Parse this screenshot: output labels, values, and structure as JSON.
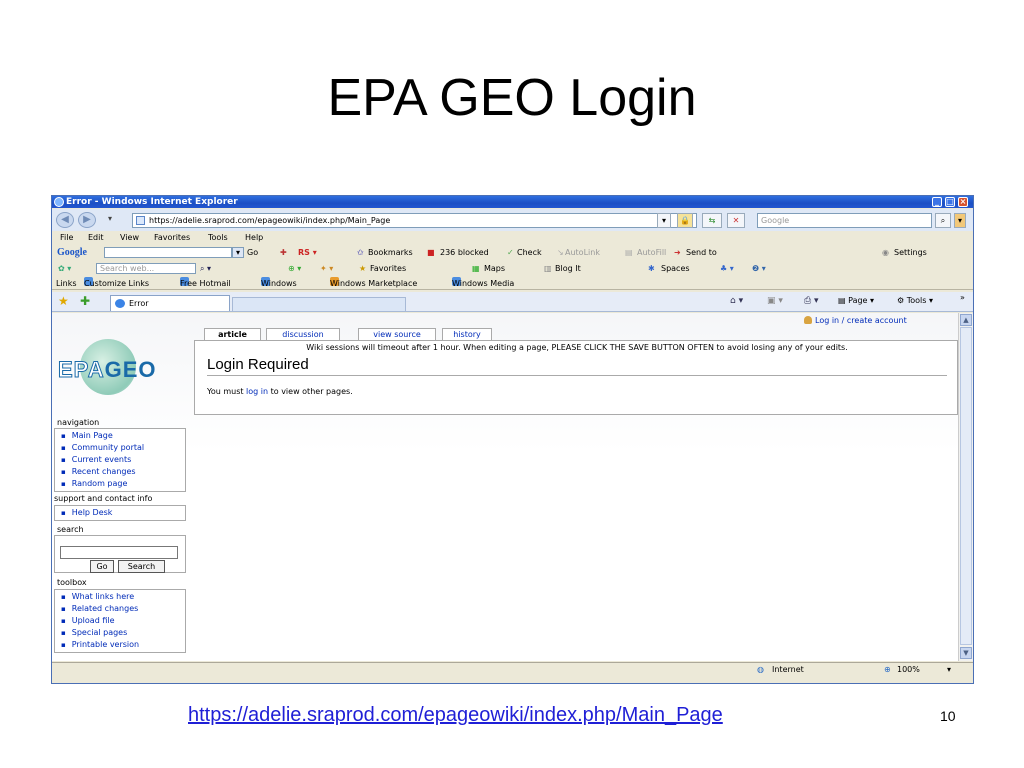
{
  "slide": {
    "title": "EPA GEO Login",
    "footer_url": "https://adelie.sraprod.com/epageowiki/index.php/Main_Page",
    "page_number": "10"
  },
  "browser": {
    "window_title": "Error - Windows Internet Explorer",
    "address": "https://adelie.sraprod.com/epageowiki/index.php/Main_Page",
    "search_placeholder": "Google",
    "menu": [
      "File",
      "Edit",
      "View",
      "Favorites",
      "Tools",
      "Help"
    ],
    "google_toolbar": {
      "logo": "Google",
      "go": "Go",
      "bookmarks": "Bookmarks",
      "blocked": "236 blocked",
      "check": "Check",
      "autolink": "AutoLink",
      "autofill": "AutoFill",
      "sendto": "Send to",
      "settings": "Settings"
    },
    "toolbar2": {
      "search_placeholder": "Search web...",
      "favorites": "Favorites",
      "maps": "Maps",
      "blogit": "Blog It",
      "spaces": "Spaces"
    },
    "links": [
      "Links",
      "Customize Links",
      "Free Hotmail",
      "Windows",
      "Windows Marketplace",
      "Windows Media"
    ],
    "tab_title": "Error",
    "command_bar": {
      "page": "Page",
      "tools": "Tools"
    },
    "status": {
      "zone": "Internet",
      "zoom": "100%"
    },
    "colors": {
      "titlebar": "#1c4fc4",
      "link": "#002bb8"
    }
  },
  "wiki": {
    "logo": {
      "ep": "EP",
      "a": "A",
      "geo": "GEO"
    },
    "login_link": "Log in / create account",
    "tabs": [
      "article",
      "discussion",
      "view source",
      "history"
    ],
    "notice": "Wiki sessions will timeout after 1 hour. When editing a page, PLEASE CLICK THE SAVE BUTTON OFTEN to avoid losing any of your edits.",
    "heading": "Login Required",
    "body_prefix": "You must",
    "body_link": "log in",
    "body_suffix": "to view other pages.",
    "navigation": {
      "title": "navigation",
      "items": [
        "Main Page",
        "Community portal",
        "Current events",
        "Recent changes",
        "Random page"
      ]
    },
    "support": {
      "title": "support and contact info",
      "items": [
        "Help Desk"
      ]
    },
    "search": {
      "title": "search",
      "go": "Go",
      "search": "Search"
    },
    "toolbox": {
      "title": "toolbox",
      "items": [
        "What links here",
        "Related changes",
        "Upload file",
        "Special pages",
        "Printable version"
      ]
    }
  }
}
